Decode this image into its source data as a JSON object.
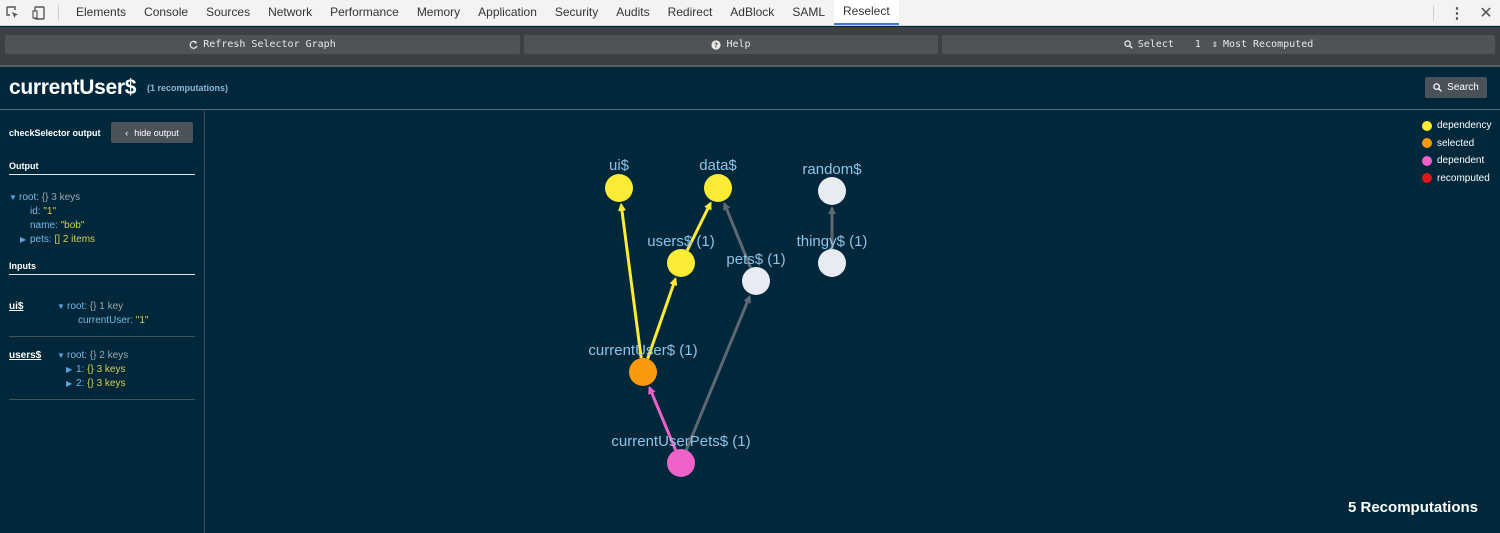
{
  "devtools": {
    "tabs": [
      "Elements",
      "Console",
      "Sources",
      "Network",
      "Performance",
      "Memory",
      "Application",
      "Security",
      "Audits",
      "Redirect",
      "AdBlock",
      "SAML",
      "Reselect"
    ],
    "active_tab": "Reselect"
  },
  "toolbar": {
    "refresh_label": "Refresh Selector Graph",
    "help_label": "Help",
    "select_label": "Select",
    "select_count": "1",
    "select_mode": "Most Recomputed"
  },
  "header": {
    "title": "currentUser$",
    "subtitle": "(1 recomputations)",
    "search_label": "Search"
  },
  "sidebar": {
    "title": "checkSelector output",
    "hide_label": "hide output",
    "output_heading": "Output",
    "output": {
      "root_key": "root:",
      "root_type": "{}",
      "root_summary": "3 keys",
      "id_key": "id:",
      "id_val": "\"1\"",
      "name_key": "name:",
      "name_val": "\"bob\"",
      "pets_key": "pets:",
      "pets_type": "[]",
      "pets_summary": "2 items"
    },
    "inputs_heading": "Inputs",
    "inputs": [
      {
        "name": "ui$",
        "root_key": "root:",
        "root_type": "{}",
        "root_summary": "1 key",
        "child_key": "currentUser:",
        "child_val": "\"1\""
      },
      {
        "name": "users$",
        "root_key": "root:",
        "root_type": "{}",
        "root_summary": "2 keys",
        "child1_key": "1:",
        "child1_type": "{}",
        "child1_summary": "3 keys",
        "child2_key": "2:",
        "child2_type": "{}",
        "child2_summary": "3 keys"
      }
    ]
  },
  "graph": {
    "nodes": [
      {
        "id": "ui",
        "label": "ui$",
        "role": "dependency"
      },
      {
        "id": "data",
        "label": "data$",
        "role": "dependency"
      },
      {
        "id": "random",
        "label": "random$",
        "role": "none"
      },
      {
        "id": "users",
        "label": "users$ (1)",
        "role": "dependency"
      },
      {
        "id": "thingy",
        "label": "thingy$ (1)",
        "role": "none"
      },
      {
        "id": "pets",
        "label": "pets$ (1)",
        "role": "none"
      },
      {
        "id": "currentUser",
        "label": "currentUser$ (1)",
        "role": "selected"
      },
      {
        "id": "currentUserPets",
        "label": "currentUserPets$ (1)",
        "role": "dependent"
      }
    ],
    "edges": [
      {
        "from": "currentUser",
        "to": "ui",
        "kind": "dependency"
      },
      {
        "from": "currentUser",
        "to": "users",
        "kind": "dependency"
      },
      {
        "from": "users",
        "to": "data",
        "kind": "dependency"
      },
      {
        "from": "pets",
        "to": "data",
        "kind": "plain"
      },
      {
        "from": "thingy",
        "to": "random",
        "kind": "plain"
      },
      {
        "from": "currentUserPets",
        "to": "pets",
        "kind": "plain"
      },
      {
        "from": "currentUserPets",
        "to": "currentUser",
        "kind": "dependent"
      }
    ],
    "colors": {
      "dependency": "#fdeb35",
      "selected": "#f89a0c",
      "dependent": "#ee62c8",
      "recomputed": "#e3171a",
      "none": "#e9ebf2",
      "plain_edge": "#5f6770",
      "label": "#8fc4e8"
    },
    "legend": [
      {
        "label": "dependency",
        "color": "#fdeb35"
      },
      {
        "label": "selected",
        "color": "#f89a0c"
      },
      {
        "label": "dependent",
        "color": "#ee62c8"
      },
      {
        "label": "recomputed",
        "color": "#e3171a"
      }
    ],
    "total_recomputations": "5 Recomputations"
  }
}
